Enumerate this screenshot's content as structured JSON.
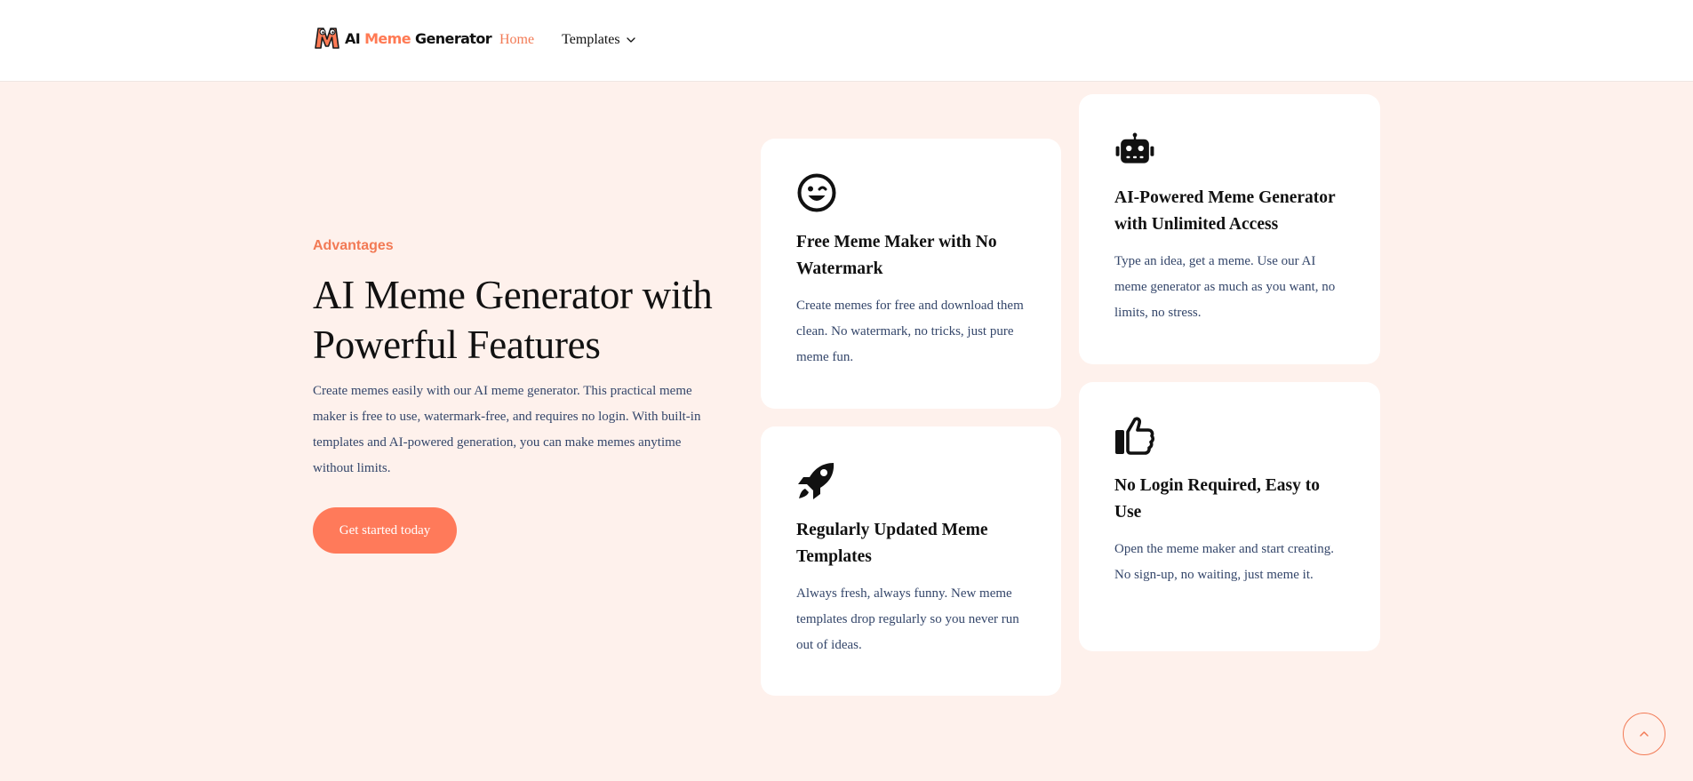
{
  "header": {
    "logo": {
      "text_prefix": "AI ",
      "text_accent": "Meme",
      "text_suffix": " Generator",
      "icon": "meme-logo-icon"
    },
    "nav": {
      "home": "Home",
      "templates": "Templates"
    }
  },
  "hero": {
    "eyebrow": "Advantages",
    "headline": "AI Meme Generator with Powerful Features",
    "lead": "Create memes easily with our AI meme generator. This practical meme maker is free to use, watermark-free, and requires no login. With built-in templates and AI-powered generation, you can make memes anytime without limits.",
    "cta": "Get started today"
  },
  "features": [
    {
      "icon": "wink-face-icon",
      "title": "Free Meme Maker with No Watermark",
      "text": "Create memes for free and download them clean. No watermark, no tricks, just pure meme fun."
    },
    {
      "icon": "robot-icon",
      "title": "AI-Powered Meme Generator with Unlimited Access",
      "text": "Type an idea, get a meme. Use our AI meme generator as much as you want, no limits, no stress."
    },
    {
      "icon": "rocket-icon",
      "title": "Regularly Updated Meme Templates",
      "text": "Always fresh, always funny. New meme templates drop regularly so you never run out of ideas."
    },
    {
      "icon": "thumbs-up-icon",
      "title": "No Login Required, Easy to Use",
      "text": "Open the meme maker and start creating. No sign-up, no waiting, just meme it."
    }
  ],
  "colors": {
    "accent": "#ff7a5a",
    "background": "#fef1ec",
    "body_text": "#34466a"
  },
  "scroll_top": {
    "icon": "chevron-up-icon"
  }
}
